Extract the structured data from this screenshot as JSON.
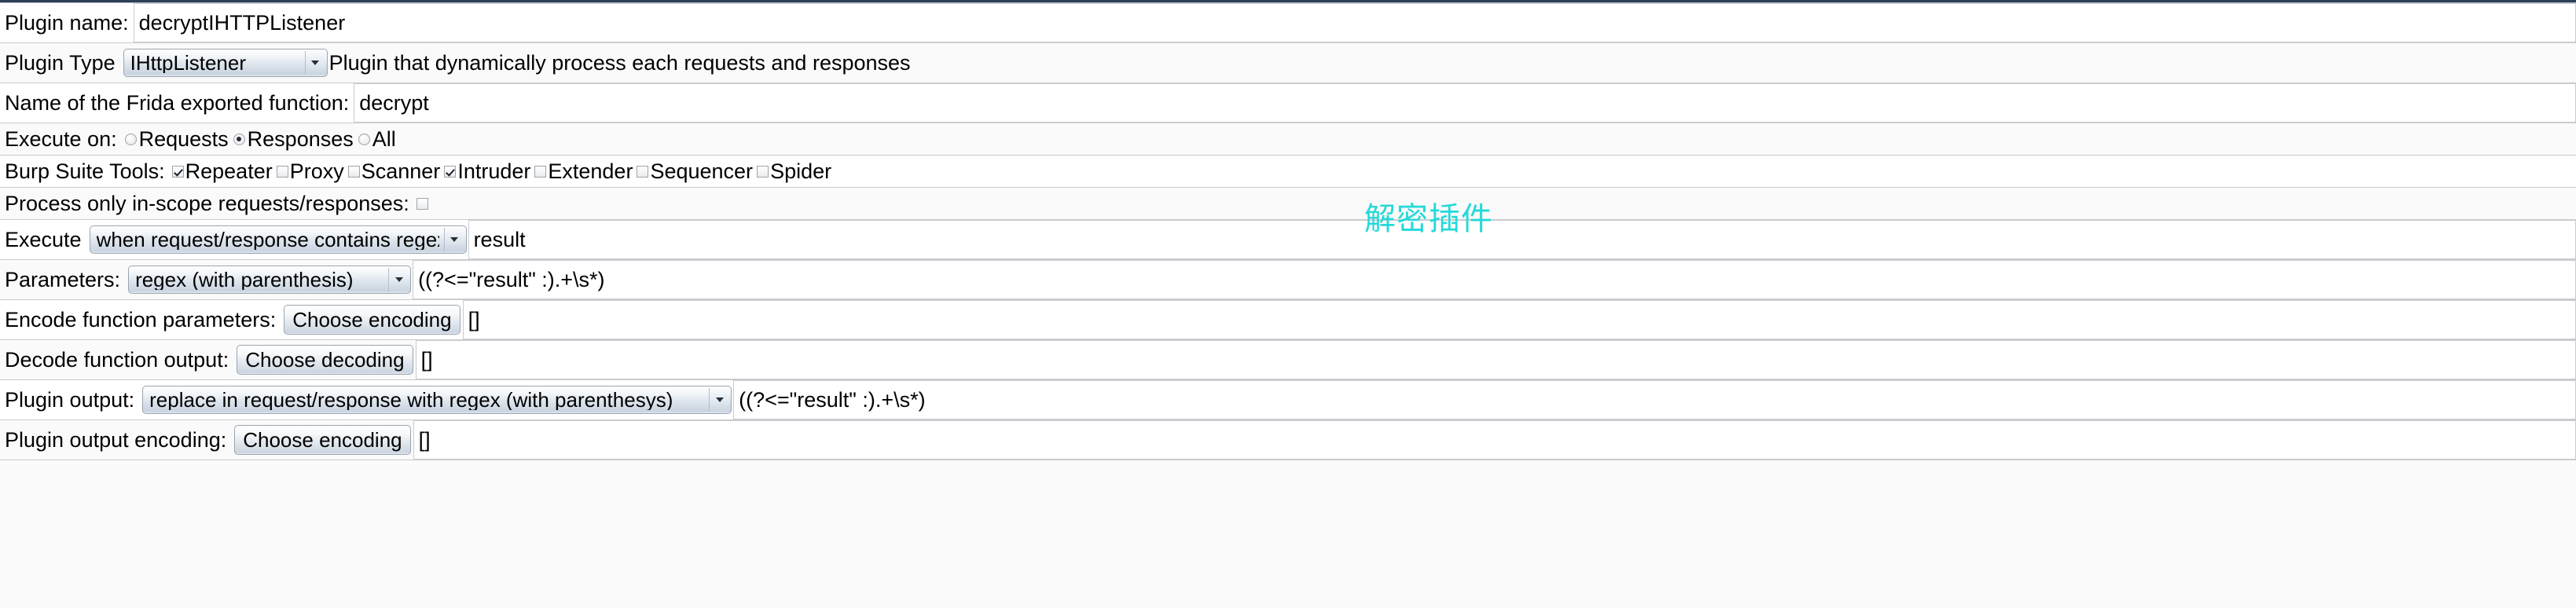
{
  "window": {
    "accent_color": "#2d3e57",
    "annotation_color": "#25D9D9"
  },
  "annotation": {
    "text": "解密插件"
  },
  "form": {
    "rows": [
      {
        "label": "Plugin name:",
        "field_type": "text",
        "value": "decryptIHTTPListener"
      },
      {
        "label": "Plugin Type",
        "field_type": "combo",
        "selected": "IHttpListener",
        "description": "Plugin that dynamically process each requests and responses"
      },
      {
        "label": "Name of the Frida exported function:",
        "field_type": "text",
        "value": "decrypt"
      },
      {
        "label": "Execute on:",
        "field_type": "radio-group",
        "options": [
          "Requests",
          "Responses",
          "All"
        ],
        "selected": "Responses"
      },
      {
        "label": "Burp Suite Tools:",
        "field_type": "checkbox-group",
        "options": [
          {
            "label": "Repeater",
            "checked": true
          },
          {
            "label": "Proxy",
            "checked": false
          },
          {
            "label": "Scanner",
            "checked": false
          },
          {
            "label": "Intruder",
            "checked": true
          },
          {
            "label": "Extender",
            "checked": false
          },
          {
            "label": "Sequencer",
            "checked": false
          },
          {
            "label": "Spider",
            "checked": false
          }
        ]
      },
      {
        "label": "Process only in-scope requests/responses:",
        "field_type": "checkbox",
        "checked": false
      },
      {
        "label": "Execute",
        "field_type": "combo-text",
        "selected": "when request/response contains regex",
        "value": "result"
      },
      {
        "label": "Parameters:",
        "field_type": "combo-text",
        "selected": "regex (with parenthesis)",
        "value": "((?<=\"result\" :).+\\s*)"
      },
      {
        "label": "Encode function parameters:",
        "field_type": "button-text",
        "button": "Choose encoding",
        "value": "[]"
      },
      {
        "label": "Decode function output:",
        "field_type": "button-text",
        "button": "Choose decoding",
        "value": "[]"
      },
      {
        "label": "Plugin output:",
        "field_type": "combo-text",
        "selected": "replace in request/response with regex (with parenthesys)",
        "value": "((?<=\"result\" :).+\\s*)"
      },
      {
        "label": "Plugin output encoding:",
        "field_type": "button-text",
        "button": "Choose encoding",
        "value": "[]"
      }
    ]
  }
}
